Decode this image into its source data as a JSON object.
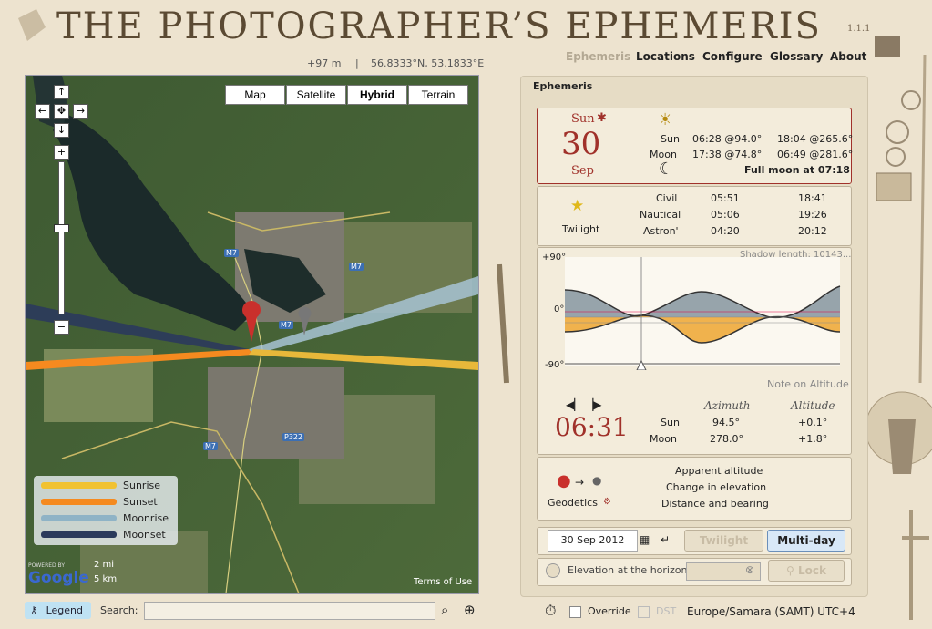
{
  "app": {
    "title": "THE PHOTOGRAPHER’S EPHEMERIS",
    "version": "1.1.1"
  },
  "location": {
    "elevation": "+97 m",
    "separator": "|",
    "coords": "56.8333°N, 53.1833°E"
  },
  "nav": [
    "Ephemeris",
    "Locations",
    "Configure",
    "Glossary",
    "About"
  ],
  "map": {
    "types": [
      "Map",
      "Satellite",
      "Hybrid",
      "Terrain"
    ],
    "active_type": "Hybrid",
    "road_labels": [
      "M7",
      "M7",
      "M7",
      "M7",
      "P322"
    ],
    "legend": [
      {
        "label": "Sunrise",
        "color": "#f1c232"
      },
      {
        "label": "Sunset",
        "color": "#f58a1f"
      },
      {
        "label": "Moonrise",
        "color": "#8fb3c6"
      },
      {
        "label": "Moonset",
        "color": "#2b3a5c"
      }
    ],
    "powered_by": "POWERED BY",
    "google": "Google",
    "scale_mi": "2 mi",
    "scale_km": "5 km",
    "terms": "Terms of Use"
  },
  "bottom": {
    "legend": "Legend",
    "search_label": "Search:",
    "search_value": ""
  },
  "panel": {
    "title": "Ephemeris",
    "date": {
      "weekday": "Sun",
      "day": "30",
      "month": "Sep"
    },
    "sun_label": "Sun",
    "sun_rise": "06:28 @94.0°",
    "sun_set": "18:04 @265.6°",
    "moon_label": "Moon",
    "moon_rise": "17:38 @74.8°",
    "moon_set": "06:49 @281.6°",
    "moon_phase": "Full moon at 07:18",
    "twilight_label": "Twilight",
    "twilight": [
      {
        "name": "Civil",
        "am": "05:51",
        "pm": "18:41"
      },
      {
        "name": "Nautical",
        "am": "05:06",
        "pm": "19:26"
      },
      {
        "name": "Astron'",
        "am": "04:20",
        "pm": "20:12"
      }
    ],
    "chart": {
      "y_top": "+90°",
      "y_mid": "0°",
      "y_bottom": "-90°",
      "shadow": "Shadow length: 10143...",
      "note": "Note on Altitude"
    },
    "time": "06:31",
    "az_header": "Azimuth",
    "alt_header": "Altitude",
    "sun_az": "94.5°",
    "sun_alt": "+0.1°",
    "moon_az": "278.0°",
    "moon_alt": "+1.8°",
    "geodetics_label": "Geodetics",
    "geodetics": [
      "Apparent altitude",
      "Change in elevation",
      "Distance and bearing"
    ],
    "date_input": "30 Sep 2012",
    "twilight_btn": "Twilight",
    "multiday_btn": "Multi-day",
    "elevation_label": "Elevation at the horizon:",
    "lock_btn": "Lock"
  },
  "footer": {
    "override": "Override",
    "dst": "DST",
    "timezone": "Europe/Samara (SAMT) UTC+4"
  },
  "colors": {
    "sun_area": "#f0b24d",
    "moon_area": "#8c9aa3",
    "sunset": "#f58a1f",
    "sunrise": "#f1c232",
    "accent_red": "#a0312a"
  }
}
